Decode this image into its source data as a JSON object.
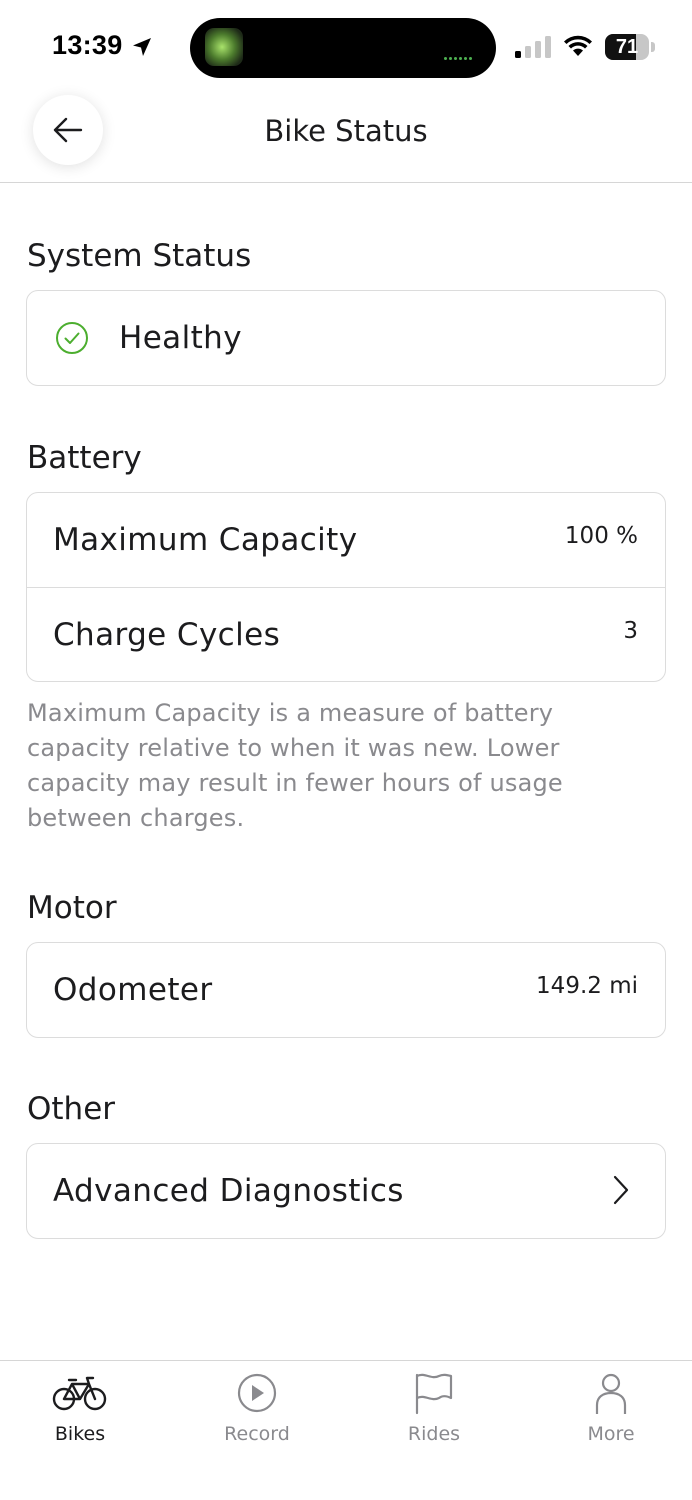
{
  "status_bar": {
    "time": "13:39",
    "battery_percent": 71,
    "battery_label": "71"
  },
  "header": {
    "title": "Bike Status"
  },
  "system_status": {
    "title": "System Status",
    "value": "Healthy",
    "status_color": "#4cae2f"
  },
  "battery": {
    "title": "Battery",
    "rows": [
      {
        "label": "Maximum Capacity",
        "value": "100 %"
      },
      {
        "label": "Charge Cycles",
        "value": "3"
      }
    ],
    "note": "Maximum Capacity is a measure of battery capacity relative to when it was new. Lower capacity may result in fewer hours of usage between charges."
  },
  "motor": {
    "title": "Motor",
    "rows": [
      {
        "label": "Odometer",
        "value": "149.2 mi"
      }
    ]
  },
  "other": {
    "title": "Other",
    "rows": [
      {
        "label": "Advanced Diagnostics"
      }
    ]
  },
  "tab_bar": {
    "tabs": [
      {
        "label": "Bikes",
        "icon": "bike-icon",
        "active": true
      },
      {
        "label": "Record",
        "icon": "play-circle-icon",
        "active": false
      },
      {
        "label": "Rides",
        "icon": "flag-icon",
        "active": false
      },
      {
        "label": "More",
        "icon": "person-icon",
        "active": false
      }
    ]
  }
}
